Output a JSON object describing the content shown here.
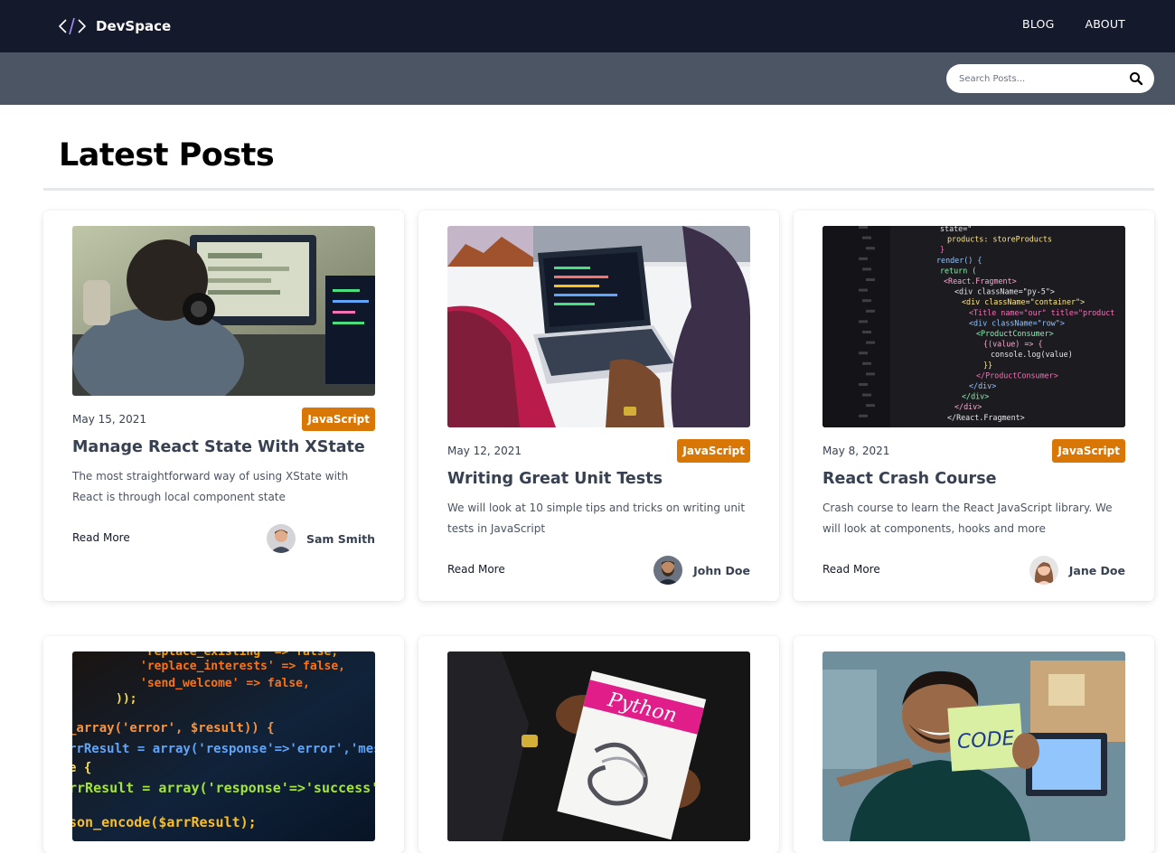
{
  "header": {
    "brand_name": "DevSpace",
    "nav": [
      {
        "label": "BLOG"
      },
      {
        "label": "ABOUT"
      }
    ]
  },
  "search": {
    "placeholder": "Search Posts..."
  },
  "main": {
    "heading": "Latest Posts"
  },
  "read_more_label": "Read More",
  "posts": [
    {
      "date": "May 15, 2021",
      "category": "JavaScript",
      "title": "Manage React State With XState",
      "excerpt": "The most straightforward way of using XState with React is through local component state",
      "author": "Sam Smith",
      "image": "person-with-headphones-coding"
    },
    {
      "date": "May 12, 2021",
      "category": "JavaScript",
      "title": "Writing Great Unit Tests",
      "excerpt": "We will look at 10 simple tips and tricks on writing unit tests in JavaScript",
      "author": "John Doe",
      "image": "laptop-with-code"
    },
    {
      "date": "May 8, 2021",
      "category": "JavaScript",
      "title": "React Crash Course",
      "excerpt": "Crash course to learn the React JavaScript library. We will look at components, hooks and more",
      "author": "Jane Doe",
      "image": "react-code-on-screen"
    },
    {
      "image": "php-code-on-screen"
    },
    {
      "image": "python-book"
    },
    {
      "image": "man-holding-code-note"
    }
  ],
  "images": {
    "code_snippet_lines": [
      "state=\"",
      "products: storeProducts",
      "}",
      "render() {",
      "return (",
      "<React.Fragment>",
      "<div className=\"py-5\">",
      "<div className=\"container\">",
      "<Title name=\"our\" title=\"product",
      "<div className=\"row\">",
      "<ProductConsumer>",
      "{(value) => {",
      "console.log(value)",
      "}}",
      "</ProductConsumer>",
      "</div>",
      "</div>",
      "</div>",
      "</React.Fragment>"
    ],
    "php_code_lines": [
      "'replace_existing' => false,",
      "'replace_interests' => false,",
      "'send_welcome'      => false,",
      "));",
      "_array('error', $result)) {",
      "rrResult = array('response'=>'error','message'",
      "e {",
      "rrResult = array('response'=>'success');",
      "",
      "son_encode($arrResult);"
    ],
    "book_title": "Python",
    "note_text": "CODE"
  },
  "colors": {
    "header_bg": "#141a2c",
    "search_bar_bg": "#4b5563",
    "tag_bg": "#d97706",
    "rule": "#e5e7eb"
  }
}
